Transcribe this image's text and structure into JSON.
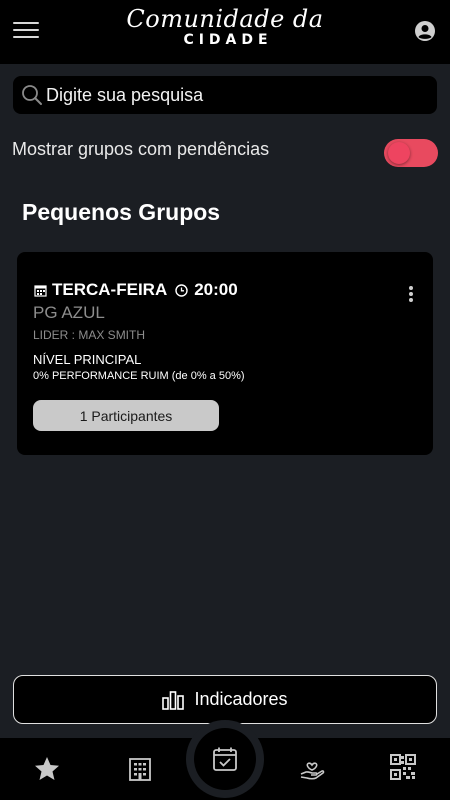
{
  "header": {
    "logo_script": "Comunidade da",
    "logo_caps": "CIDADE",
    "menu_icon": "hamburger-menu-icon",
    "profile_icon": "account-circle-icon"
  },
  "search": {
    "placeholder": "Digite sua pesquisa",
    "icon": "search-icon"
  },
  "filter": {
    "label": "Mostrar grupos com pendências",
    "enabled": true,
    "accent": "#e84a5f"
  },
  "section": {
    "title": "Pequenos Grupos"
  },
  "groups": [
    {
      "day": "TERCA-FEIRA",
      "time": "20:00",
      "name": "PG AZUL",
      "leader": "LIDER : MAX SMITH",
      "level": "NÍVEL PRINCIPAL",
      "performance": "0% PERFORMANCE RUIM",
      "performance_range": "(de 0% a 50%)",
      "participants_label": "1 Participantes"
    }
  ],
  "actions": {
    "indicators_label": "Indicadores"
  },
  "bottom_nav": [
    "star-icon",
    "building-icon",
    "calendar-check-icon",
    "hand-heart-icon",
    "qr-code-icon"
  ]
}
